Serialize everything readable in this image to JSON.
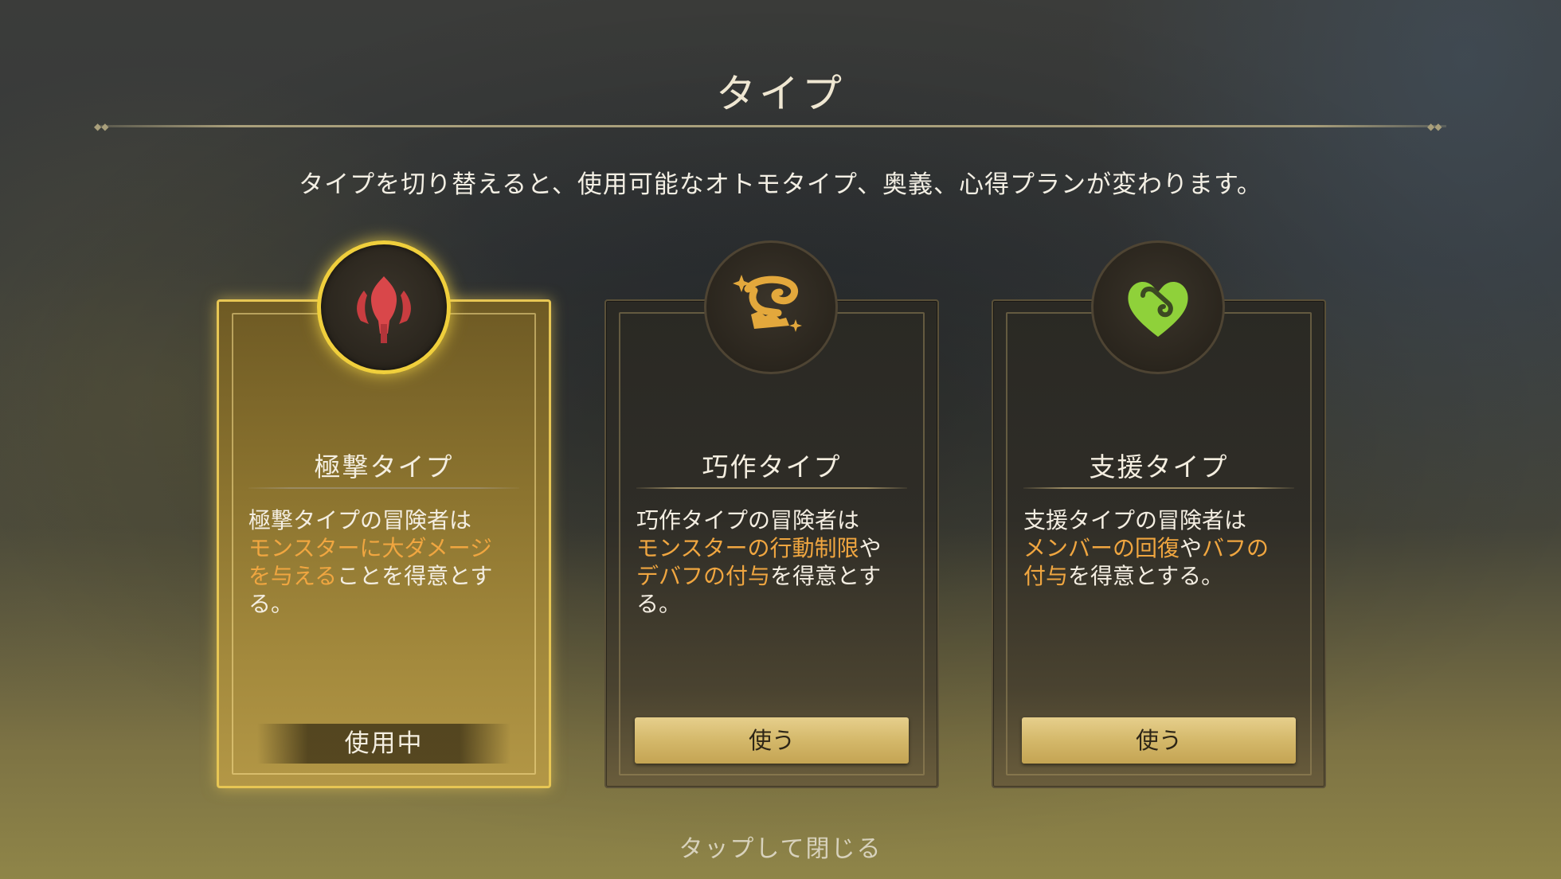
{
  "header": {
    "title": "タイプ",
    "subtitle": "タイプを切り替えると、使用可能なオトモタイプ、奥義、心得プランが変わります。"
  },
  "cards": [
    {
      "name": "極撃タイプ",
      "icon": "trident-icon",
      "icon_color": "#d9474a",
      "desc_lead": "極撃タイプの冒険者は",
      "desc_hl1": "モンスターに大ダメージを与える",
      "desc_mid": "ことを得意とする。",
      "desc_hl2": "",
      "desc_tail": "",
      "status": "使用中",
      "selected": true
    },
    {
      "name": "巧作タイプ",
      "icon": "spiral-scroll-icon",
      "icon_color": "#e3a83c",
      "desc_lead": "巧作タイプの冒険者は",
      "desc_hl1": "モンスターの行動制限",
      "desc_mid": "や",
      "desc_hl2": "デバフの付与",
      "desc_tail": "を得意とする。",
      "status": "使う",
      "selected": false
    },
    {
      "name": "支援タイプ",
      "icon": "heart-spiral-icon",
      "icon_color": "#8fd13a",
      "desc_lead": "支援タイプの冒険者は",
      "desc_hl1": "メンバーの回復",
      "desc_mid": "や",
      "desc_hl2": "バフの付与",
      "desc_tail": "を得意とする。",
      "status": "使う",
      "selected": false
    }
  ],
  "footer": {
    "close_hint": "タップして閉じる"
  },
  "colors": {
    "highlight": "#f0a640",
    "selected_border": "#e7c654",
    "button_gold": "#d4b86a"
  }
}
